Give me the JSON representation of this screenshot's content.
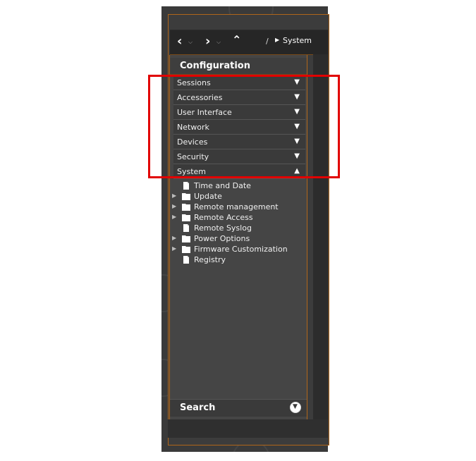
{
  "toolbar": {
    "back_icon": "chevron-left-icon",
    "forward_icon": "chevron-right-icon",
    "up_icon": "chevron-up-icon",
    "breadcrumb_separator": "/",
    "breadcrumb_current": "System"
  },
  "panel": {
    "title": "Configuration",
    "sections": [
      {
        "label": "Sessions",
        "state": "collapsed"
      },
      {
        "label": "Accessories",
        "state": "collapsed"
      },
      {
        "label": "User Interface",
        "state": "collapsed"
      },
      {
        "label": "Network",
        "state": "collapsed"
      },
      {
        "label": "Devices",
        "state": "collapsed"
      },
      {
        "label": "Security",
        "state": "collapsed"
      },
      {
        "label": "System",
        "state": "expanded"
      }
    ],
    "tree": [
      {
        "label": "Time and Date",
        "type": "file",
        "expandable": false
      },
      {
        "label": "Update",
        "type": "folder",
        "expandable": true
      },
      {
        "label": "Remote management",
        "type": "folder",
        "expandable": true
      },
      {
        "label": "Remote Access",
        "type": "folder",
        "expandable": true
      },
      {
        "label": "Remote Syslog",
        "type": "file",
        "expandable": false
      },
      {
        "label": "Power Options",
        "type": "folder",
        "expandable": true
      },
      {
        "label": "Firmware Customization",
        "type": "folder",
        "expandable": true
      },
      {
        "label": "Registry",
        "type": "file",
        "expandable": false
      }
    ],
    "search_label": "Search"
  },
  "colors": {
    "accent": "#b0661a",
    "highlight": "#e10000",
    "panel_bg": "#454545"
  }
}
